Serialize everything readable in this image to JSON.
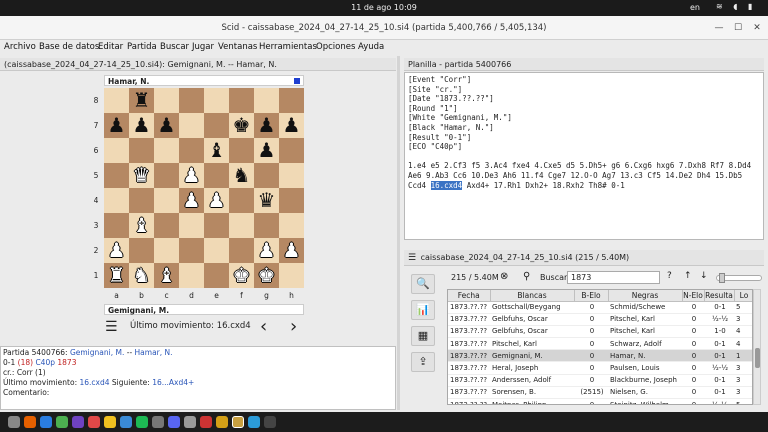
{
  "topbar": {
    "clock": "11 de ago  10:09",
    "lang": "en",
    "tray": "≋ ◖ ▮"
  },
  "window": {
    "title": "Scid - caissabase_2024_04_27-14_25_10.si4 (partida 5,400,766 / 5,405,134)",
    "close": "✕",
    "minimize": "—",
    "maximize": "☐"
  },
  "menu": [
    "Archivo",
    "Base de datos",
    "Editar",
    "Partida",
    "Buscar",
    "Jugar",
    "Ventanas",
    "Herramientas",
    "Opciones",
    "Ayuda"
  ],
  "left_pane": {
    "header": "(caissabase_2024_04_27-14_25_10.si4): Gemignani, M. -- Hamar, N."
  },
  "board": {
    "top_player": "Hamar, N.",
    "bottom_player": "Gemignani, M.",
    "last_move_label": "Último movimiento: 16.cxd4",
    "ranks": [
      "8",
      "7",
      "6",
      "5",
      "4",
      "3",
      "2",
      "1"
    ],
    "files": [
      "a",
      "b",
      "c",
      "d",
      "e",
      "f",
      "g",
      "h"
    ],
    "position": [
      [
        "",
        "bR",
        "",
        "",
        "",
        "",
        "",
        ""
      ],
      [
        "bP",
        "bP",
        "bP",
        "",
        "",
        "bK",
        "bP",
        "bP"
      ],
      [
        "",
        "",
        "",
        "",
        "bB",
        "",
        "bP",
        ""
      ],
      [
        "",
        "wQ",
        "",
        "wP",
        "",
        "bN",
        "",
        ""
      ],
      [
        "",
        "",
        "",
        "wP",
        "wP",
        "",
        "bQ",
        ""
      ],
      [
        "",
        "wB",
        "",
        "",
        "",
        "",
        "",
        ""
      ],
      [
        "wP",
        "",
        "",
        "",
        "",
        "",
        "wP",
        "wP"
      ],
      [
        "wR",
        "wN",
        "wB",
        "",
        "",
        "wK",
        "wK",
        ""
      ]
    ]
  },
  "info": {
    "line1_label": "Partida 5400766:",
    "white": "Gemignani, M.",
    "sep": "--",
    "black": "Hamar, N.",
    "result": "0-1",
    "moves": "(18)",
    "eco": "C40p",
    "year": "1873",
    "line3": "cr.:  Corr (1)",
    "last_label": "Último movimiento:",
    "last_move": "16.cxd4",
    "next_label": "Siguiente:",
    "next_move": "16...Axd4+",
    "comment": "Comentario:"
  },
  "pgn_pane": {
    "header": "Planilla - partida 5400766",
    "tags": "[Event \"Corr\"]\n[Site \"cr.\"]\n[Date \"1873.??.??\"]\n[Round \"1\"]\n[White \"Gemignani, M.\"]\n[Black \"Hamar, N.\"]\n[Result \"0-1\"]\n[ECO \"C40p\"]",
    "moves_before": "1.e4 e5 2.Cf3 f5 3.Ac4 fxe4 4.Cxe5 d5 5.Dh5+ g6 6.Cxg6 hxg6 7.Dxh8 Rf7 8.Dd4 Ae6 9.Ab3 Cc6 10.De3 Ah6 11.f4 Cge7 12.O-O Ag7 13.c3 Cf5 14.De2 Dh4 15.Db5 Ccd4 ",
    "current": "16.cxd4",
    "moves_after": " Axd4+ 17.Rh1 Dxh2+ 18.Rxh2 Th8# 0-1"
  },
  "gamelist": {
    "header": "caissabase_2024_04_27-14_25_10.si4 (215 / 5.40M)",
    "count": "215 / 5.40M",
    "search_label": "Buscar",
    "search_value": "1873",
    "columns": [
      "Fecha",
      "Blancas",
      "B-Elo",
      "Negras",
      "N-Elo",
      "Resulta",
      "Lo"
    ],
    "rows": [
      [
        "1873.??.??",
        "Gottschall/Beygang",
        "0",
        "Schmid/Schewe",
        "0",
        "0-1",
        "5"
      ],
      [
        "1873.??.??",
        "Gelbfuhs, Oscar",
        "0",
        "Pitschel, Karl",
        "0",
        "½-½",
        "3"
      ],
      [
        "1873.??.??",
        "Gelbfuhs, Oscar",
        "0",
        "Pitschel, Karl",
        "0",
        "1-0",
        "4"
      ],
      [
        "1873.??.??",
        "Pitschel, Karl",
        "0",
        "Schwarz, Adolf",
        "0",
        "0-1",
        "4"
      ],
      [
        "1873.??.??",
        "Gemignani, M.",
        "0",
        "Hamar, N.",
        "0",
        "0-1",
        "1"
      ],
      [
        "1873.??.??",
        "Heral, Joseph",
        "0",
        "Paulsen, Louis",
        "0",
        "½-½",
        "3"
      ],
      [
        "1873.??.??",
        "Anderssen, Adolf",
        "0",
        "Blackburne, Joseph",
        "0",
        "0-1",
        "3"
      ],
      [
        "1873.??.??",
        "Sorensen, B.",
        "(2515)",
        "Nielsen, G.",
        "0",
        "0-1",
        "3"
      ],
      [
        "1873.??.??",
        "Meitner, Philipp",
        "0",
        "Steinitz, Wilhelm",
        "0",
        "½-½",
        "5"
      ]
    ],
    "selected_row": 4
  }
}
